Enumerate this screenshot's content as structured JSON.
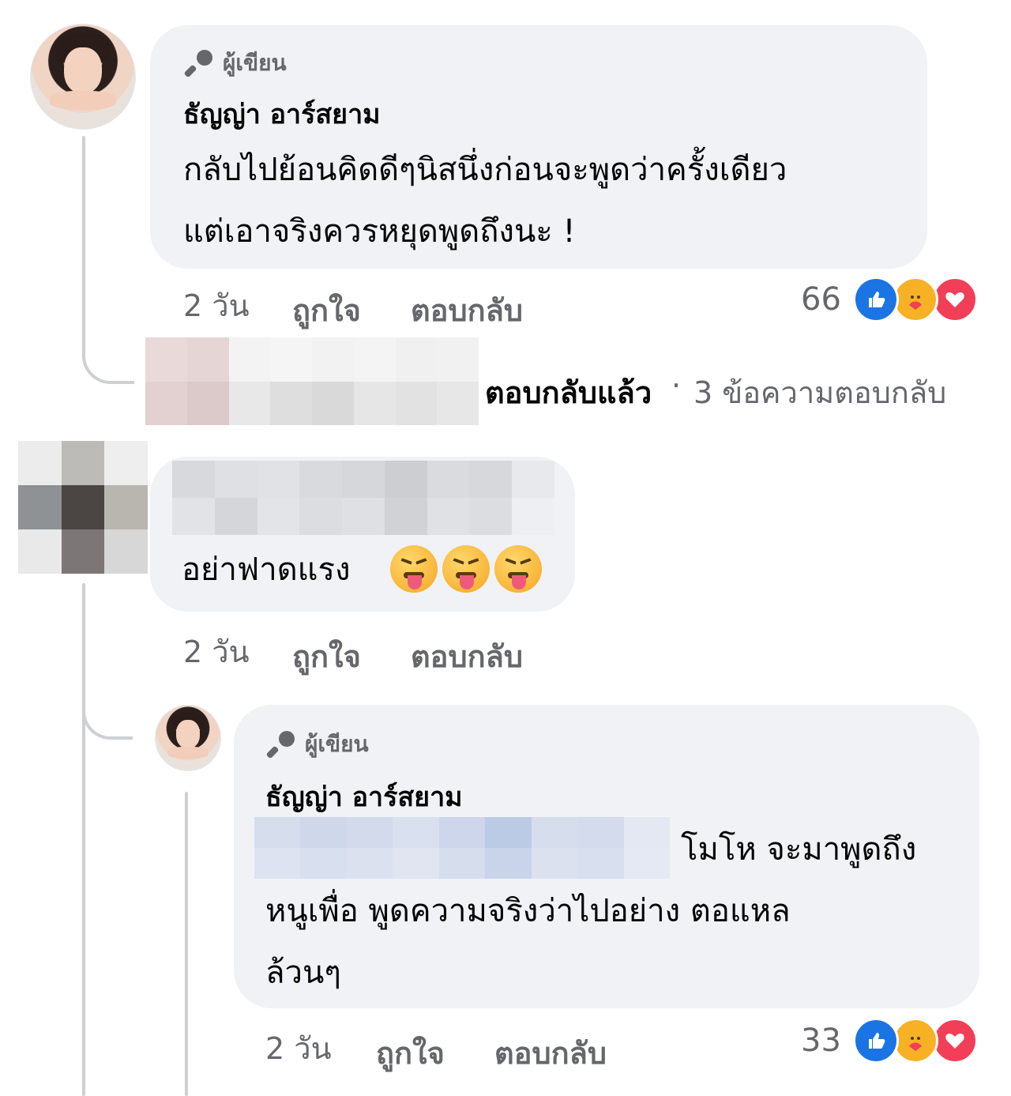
{
  "comment1": {
    "author_badge": "ผู้เขียน",
    "author_name": "ธัญญ่า อาร์สยาม",
    "lines": [
      "กลับไปย้อนคิดดีๆนิสนึ่งก่อนจะพูดว่าครั้งเดียว",
      "แต่เอาจริงควรหยุดพูดถึงนะ !"
    ],
    "time": "2 วัน",
    "like_label": "ถูกใจ",
    "reply_label": "ตอบกลับ",
    "reaction_count": "66",
    "reactions": [
      "like-icon",
      "care-icon",
      "love-icon"
    ]
  },
  "replies_summary": {
    "replied_label": "ตอบกลับแล้ว",
    "separator": "·",
    "count_text": "3 ข้อความตอบกลับ"
  },
  "comment2": {
    "text": "อย่าฟาดแรง",
    "emojis": [
      "squinting-face-with-tongue-icon",
      "squinting-face-with-tongue-icon",
      "squinting-face-with-tongue-icon"
    ],
    "time": "2 วัน",
    "like_label": "ถูกใจ",
    "reply_label": "ตอบกลับ"
  },
  "comment3": {
    "author_badge": "ผู้เขียน",
    "author_name": "ธัญญ่า อาร์สยาม",
    "line1_suffix": "โมโห จะมาพูดถึง",
    "line2": "หนูเพื่อ พูดความจริงว่าไปอย่าง ตอแหล",
    "line3": "ล้วนๆ",
    "time": "2 วัน",
    "like_label": "ถูกใจ",
    "reply_label": "ตอบกลับ",
    "reaction_count": "33",
    "reactions": [
      "like-icon",
      "care-icon",
      "love-icon"
    ]
  },
  "colors": {
    "bubble": "#f0f2f5",
    "meta_text": "#65676b",
    "like": "#1b74e4",
    "care": "#f7b125",
    "love": "#f33e58"
  }
}
